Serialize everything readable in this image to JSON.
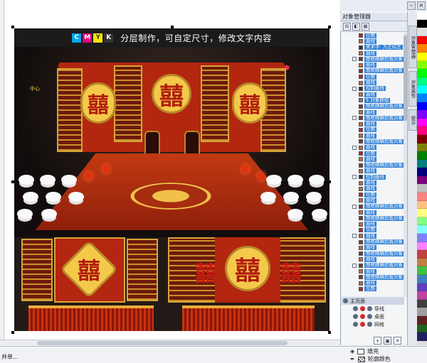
{
  "banner": {
    "cmyk_letters": [
      "C",
      "M",
      "Y",
      "K"
    ],
    "cmyk_colors": [
      "#00a6e6",
      "#e6007e",
      "#ffe600",
      "#333333"
    ],
    "text": "分层制作，可自定尺寸，修改文字内容"
  },
  "artwork": {
    "glyph": "囍",
    "corner_note": "中心"
  },
  "docker": {
    "title": "对象管理器",
    "objects": [
      {
        "label": "位图",
        "swatch": "#b8272a",
        "highlight": true
      },
      {
        "label": "曲线",
        "swatch": "#c86a30",
        "highlight": true
      },
      {
        "label": "美术字: 方正综艺",
        "swatch": "#333333",
        "highlight": true
      },
      {
        "label": "曲线",
        "swatch": "#c86a30",
        "highlight": true
      },
      {
        "label": "图框精确剪裁对象",
        "swatch": "#7a3a2a",
        "highlight": true
      },
      {
        "label": "曲线",
        "swatch": "#c86a30",
        "highlight": true
      },
      {
        "label": "图框精确剪裁对象",
        "swatch": "#7a3a2a",
        "highlight": true
      },
      {
        "label": "位图",
        "swatch": "#b8272a",
        "highlight": true
      },
      {
        "label": "曲线",
        "swatch": "#c86a30",
        "highlight": true
      },
      {
        "label": "控制曲线",
        "swatch": "#333333",
        "highlight": true
      },
      {
        "label": "曲线",
        "swatch": "#c86a30",
        "highlight": true
      },
      {
        "label": "5 对象群组",
        "swatch": "#777777",
        "highlight": true
      },
      {
        "label": "图框精确剪裁对象",
        "swatch": "#7a3a2a",
        "highlight": true
      },
      {
        "label": "曲线",
        "swatch": "#c86a30",
        "highlight": true
      },
      {
        "label": "图框精确剪裁对象",
        "swatch": "#7a3a2a",
        "highlight": true
      },
      {
        "label": "曲线",
        "swatch": "#c86a30",
        "highlight": true
      },
      {
        "label": "位图",
        "swatch": "#b8272a",
        "highlight": true
      },
      {
        "label": "曲线",
        "swatch": "#c86a30",
        "highlight": true
      },
      {
        "label": "图框精确剪裁对象",
        "swatch": "#7a3a2a",
        "highlight": true
      },
      {
        "label": "曲线",
        "swatch": "#c86a30",
        "highlight": true
      },
      {
        "label": "位图",
        "swatch": "#b8272a",
        "highlight": true
      },
      {
        "label": "曲线",
        "swatch": "#c86a30",
        "highlight": true
      },
      {
        "label": "图框精确剪裁对象",
        "swatch": "#7a3a2a",
        "highlight": true
      },
      {
        "label": "曲线",
        "swatch": "#c86a30",
        "highlight": true
      },
      {
        "label": "控制曲线",
        "swatch": "#333333",
        "highlight": true
      },
      {
        "label": "曲线",
        "swatch": "#c86a30",
        "highlight": true
      },
      {
        "label": "曲线",
        "swatch": "#c86a30",
        "highlight": true
      },
      {
        "label": "位图",
        "swatch": "#b8272a",
        "highlight": true
      },
      {
        "label": "曲线",
        "swatch": "#c86a30",
        "highlight": true
      },
      {
        "label": "图框精确剪裁对象",
        "swatch": "#7a3a2a",
        "highlight": true
      },
      {
        "label": "曲线",
        "swatch": "#c86a30",
        "highlight": true
      },
      {
        "label": "图框精确剪裁对象",
        "swatch": "#7a3a2a",
        "highlight": true
      },
      {
        "label": "曲线",
        "swatch": "#c86a30",
        "highlight": true
      },
      {
        "label": "位图",
        "swatch": "#b8272a",
        "highlight": true
      },
      {
        "label": "曲线",
        "swatch": "#c86a30",
        "highlight": true
      },
      {
        "label": "图框精确剪裁对象",
        "swatch": "#7a3a2a",
        "highlight": true
      },
      {
        "label": "曲线",
        "swatch": "#c86a30",
        "highlight": true
      },
      {
        "label": "图框精确剪裁对象",
        "swatch": "#7a3a2a",
        "highlight": true
      },
      {
        "label": "曲线",
        "swatch": "#c86a30",
        "highlight": true
      },
      {
        "label": "图框精确剪裁对象",
        "swatch": "#7a3a2a",
        "highlight": true
      },
      {
        "label": "曲线",
        "swatch": "#c86a30",
        "highlight": true
      },
      {
        "label": "图框精确剪裁对象",
        "swatch": "#7a3a2a",
        "highlight": true
      },
      {
        "label": "曲线",
        "swatch": "#c86a30",
        "highlight": true
      },
      {
        "label": "位图",
        "swatch": "#b8272a",
        "highlight": true
      }
    ],
    "layers": [
      {
        "label": "主页面",
        "main": true
      },
      {
        "label": "导线",
        "main": false
      },
      {
        "label": "桌面",
        "main": false
      },
      {
        "label": "网格",
        "main": false
      }
    ]
  },
  "side_tabs": [
    "对象管理器",
    "对象属性",
    "提示"
  ],
  "status": {
    "left": "并单...",
    "fill_label": "填充",
    "outline_label": "轮廓颜色"
  },
  "palette": [
    "#ffffff",
    "#000000",
    "#e0e0e0",
    "#ff0000",
    "#ff8000",
    "#ffff00",
    "#80ff00",
    "#00ff00",
    "#00ff80",
    "#00ffff",
    "#0080ff",
    "#0000ff",
    "#8000ff",
    "#ff00ff",
    "#ff0080",
    "#800000",
    "#808000",
    "#008000",
    "#008080",
    "#000080",
    "#800080",
    "#c0c0c0",
    "#ff8080",
    "#ffc080",
    "#ffff80",
    "#80ff80",
    "#80ffff",
    "#8080ff",
    "#ff80ff",
    "#c04040",
    "#c08040",
    "#40c040",
    "#4080c0",
    "#6040c0",
    "#c040a0",
    "#404040",
    "#a0a0a0",
    "#602020",
    "#206020",
    "#202060"
  ]
}
